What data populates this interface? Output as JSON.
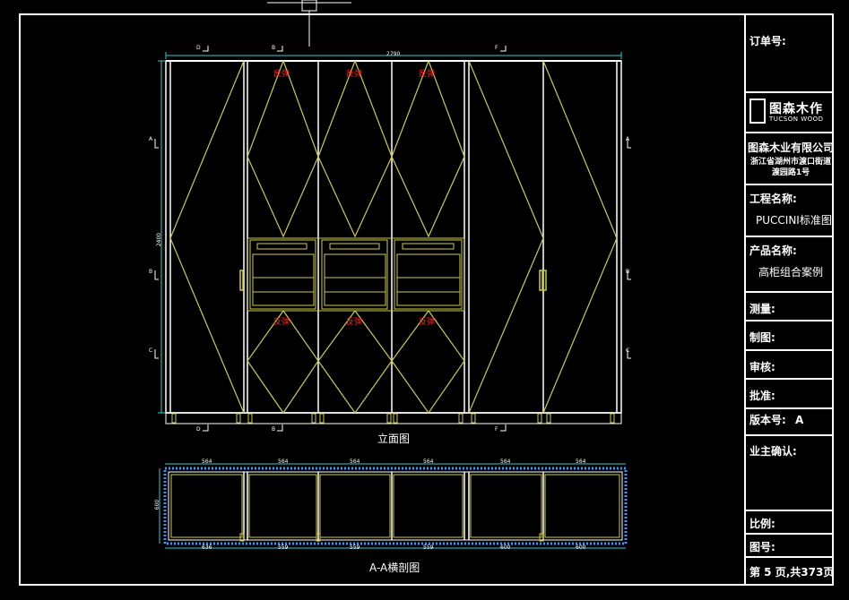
{
  "drawing": {
    "elevation_caption": "立面图",
    "section_caption": "A-A横剖图",
    "fixed_panel_label": "反弹",
    "overall_width": "2790",
    "overall_height": "2400",
    "section_depth": "600",
    "section_top_dims": [
      "564",
      "564",
      "564",
      "564",
      "564",
      "564"
    ],
    "section_bottom_dims": [
      "636",
      "559",
      "559",
      "559",
      "600",
      "600"
    ],
    "section_marks": [
      "D",
      "B",
      "F",
      "D",
      "B",
      "F"
    ],
    "side_marks": [
      "A",
      "B",
      "C",
      "A",
      "B",
      "C"
    ]
  },
  "title_block": {
    "order_no_label": "订单号:",
    "logo_cn": "图森木作",
    "logo_en": "TUCSON WOOD",
    "company": "图森木业有限公司",
    "address": "浙江省湖州市渡口街道渡园路1号",
    "project_label": "工程名称:",
    "project_value": "PUCCINI标准图",
    "product_label": "产品名称:",
    "product_value": "高柜组合案例",
    "measure_label": "测量:",
    "draw_label": "制图:",
    "review_label": "审核:",
    "approve_label": "批准:",
    "version_label": "版本号:",
    "version_value": "A",
    "owner_label": "业主确认:",
    "scale_label": "比例:",
    "drawing_no_label": "图号:",
    "page_info": "第 5 页,共373页"
  }
}
